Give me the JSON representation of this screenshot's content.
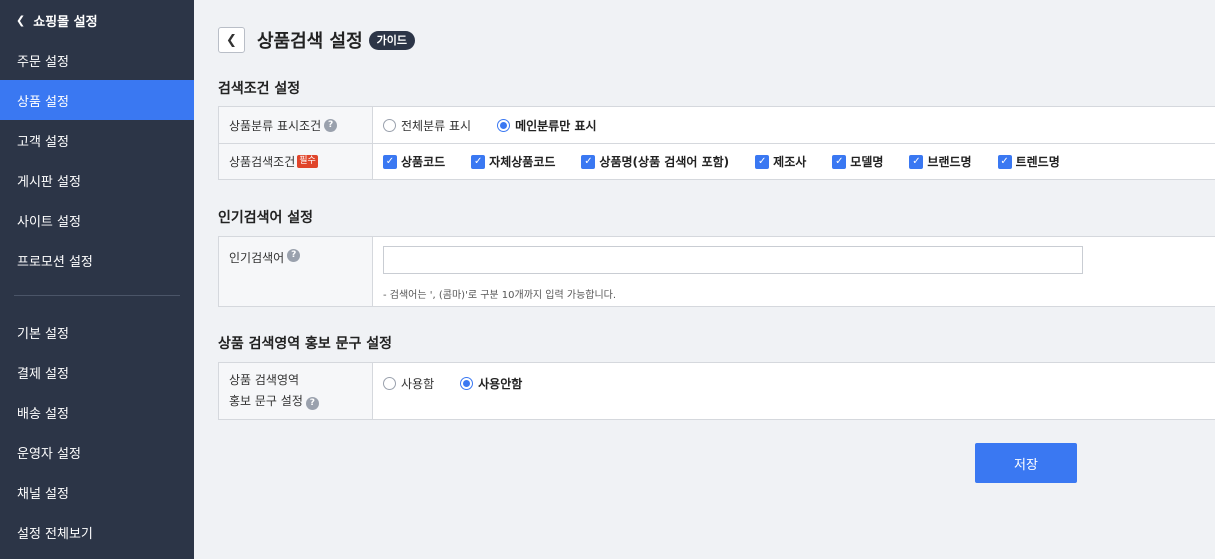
{
  "sidebar": {
    "back_label": "쇼핑몰 설정",
    "items_top": [
      {
        "label": "주문 설정"
      },
      {
        "label": "상품 설정",
        "active": true
      },
      {
        "label": "고객 설정"
      },
      {
        "label": "게시판 설정"
      },
      {
        "label": "사이트 설정"
      },
      {
        "label": "프로모션 설정"
      }
    ],
    "items_bottom": [
      {
        "label": "기본 설정"
      },
      {
        "label": "결제 설정"
      },
      {
        "label": "배송 설정"
      },
      {
        "label": "운영자 설정"
      },
      {
        "label": "채널 설정"
      },
      {
        "label": "설정 전체보기"
      }
    ]
  },
  "header": {
    "title": "상품검색 설정",
    "guide_badge": "가이드"
  },
  "section1": {
    "title": "검색조건 설정",
    "row1": {
      "label": "상품분류 표시조건",
      "options": [
        "전체분류 표시",
        "메인분류만 표시"
      ],
      "selected": "메인분류만 표시"
    },
    "row2": {
      "label": "상품검색조건",
      "required_badge": "필수",
      "checkboxes": [
        "상품코드",
        "자체상품코드",
        "상품명(상품 검색어 포함)",
        "제조사",
        "모델명",
        "브랜드명",
        "트렌드명"
      ]
    }
  },
  "section2": {
    "title": "인기검색어 설정",
    "row1": {
      "label": "인기검색어",
      "input_value": "",
      "note": "- 검색어는 ', (콤마)'로 구분 10개까지 입력 가능합니다."
    }
  },
  "section3": {
    "title": "상품 검색영역 홍보 문구 설정",
    "row1": {
      "label_line1": "상품 검색영역",
      "label_line2": "홍보 문구 설정",
      "options": [
        "사용함",
        "사용안함"
      ],
      "selected": "사용안함"
    }
  },
  "save_label": "저장",
  "colors": {
    "sidebar_bg": "#2c3547",
    "accent": "#3a78f2",
    "required": "#e0452b"
  }
}
